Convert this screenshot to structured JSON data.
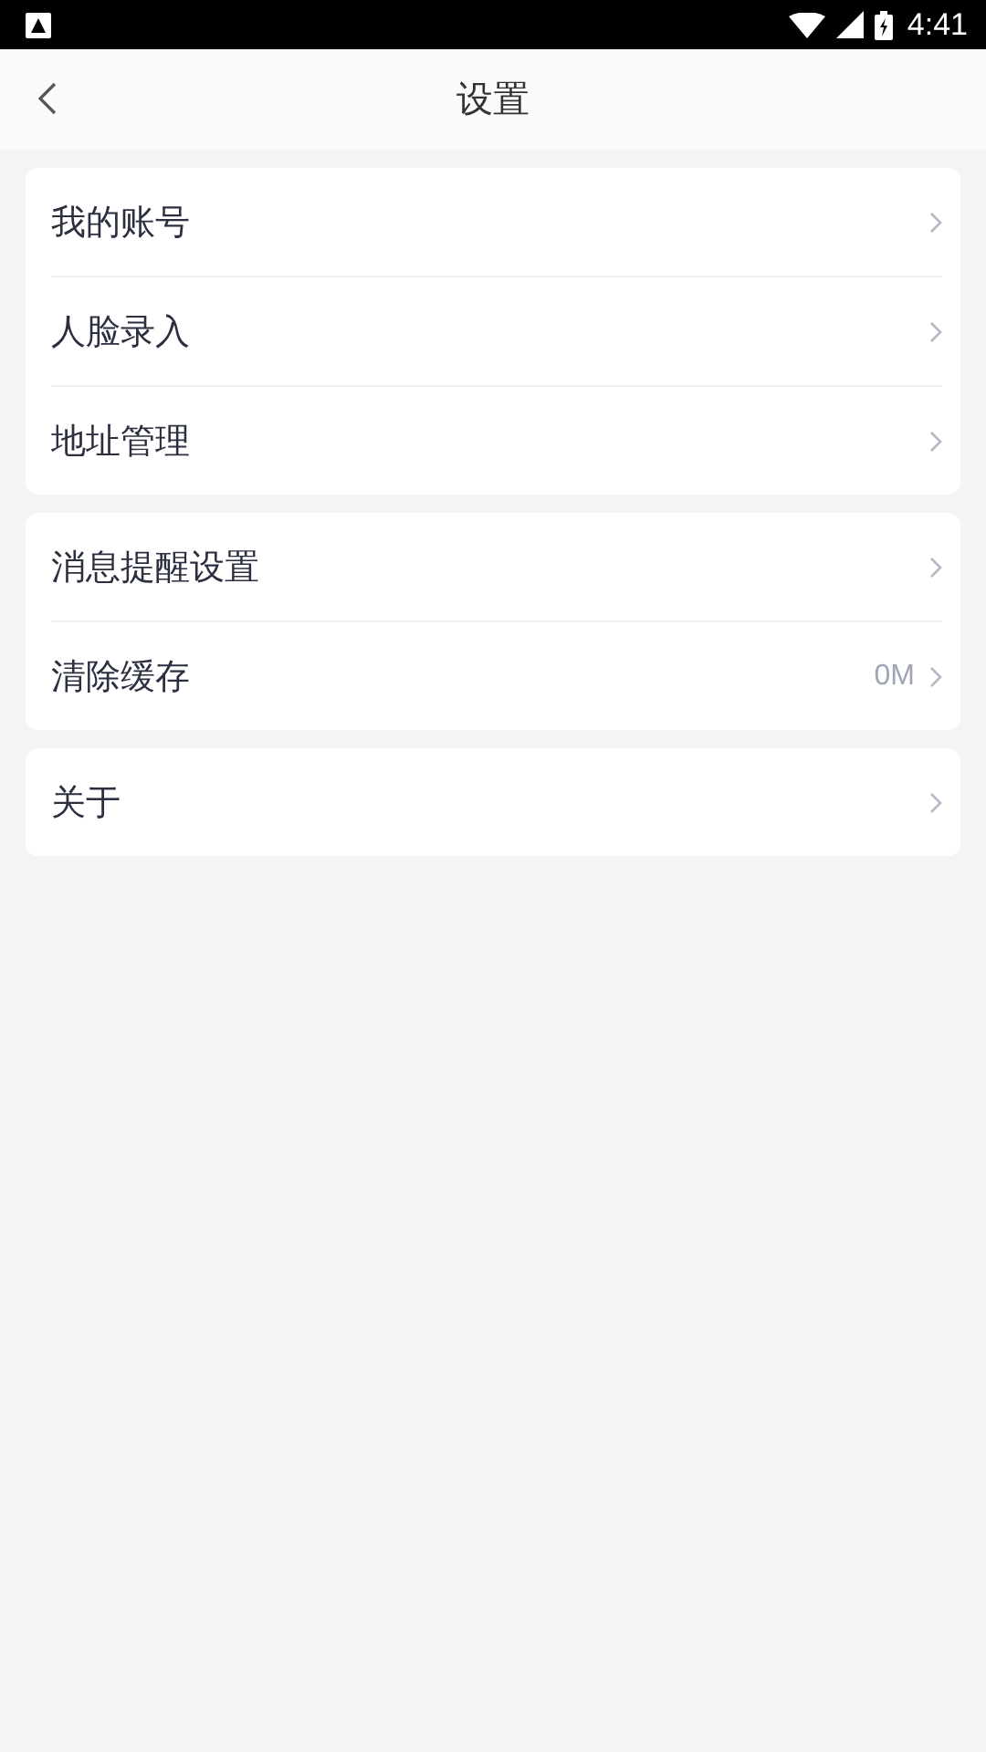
{
  "status_bar": {
    "time": "4:41"
  },
  "header": {
    "title": "设置"
  },
  "groups": [
    {
      "items": [
        {
          "label": "我的账号"
        },
        {
          "label": "人脸录入"
        },
        {
          "label": "地址管理"
        }
      ]
    },
    {
      "items": [
        {
          "label": "消息提醒设置"
        },
        {
          "label": "清除缓存",
          "value": "0M"
        }
      ]
    },
    {
      "items": [
        {
          "label": "关于"
        }
      ]
    }
  ]
}
